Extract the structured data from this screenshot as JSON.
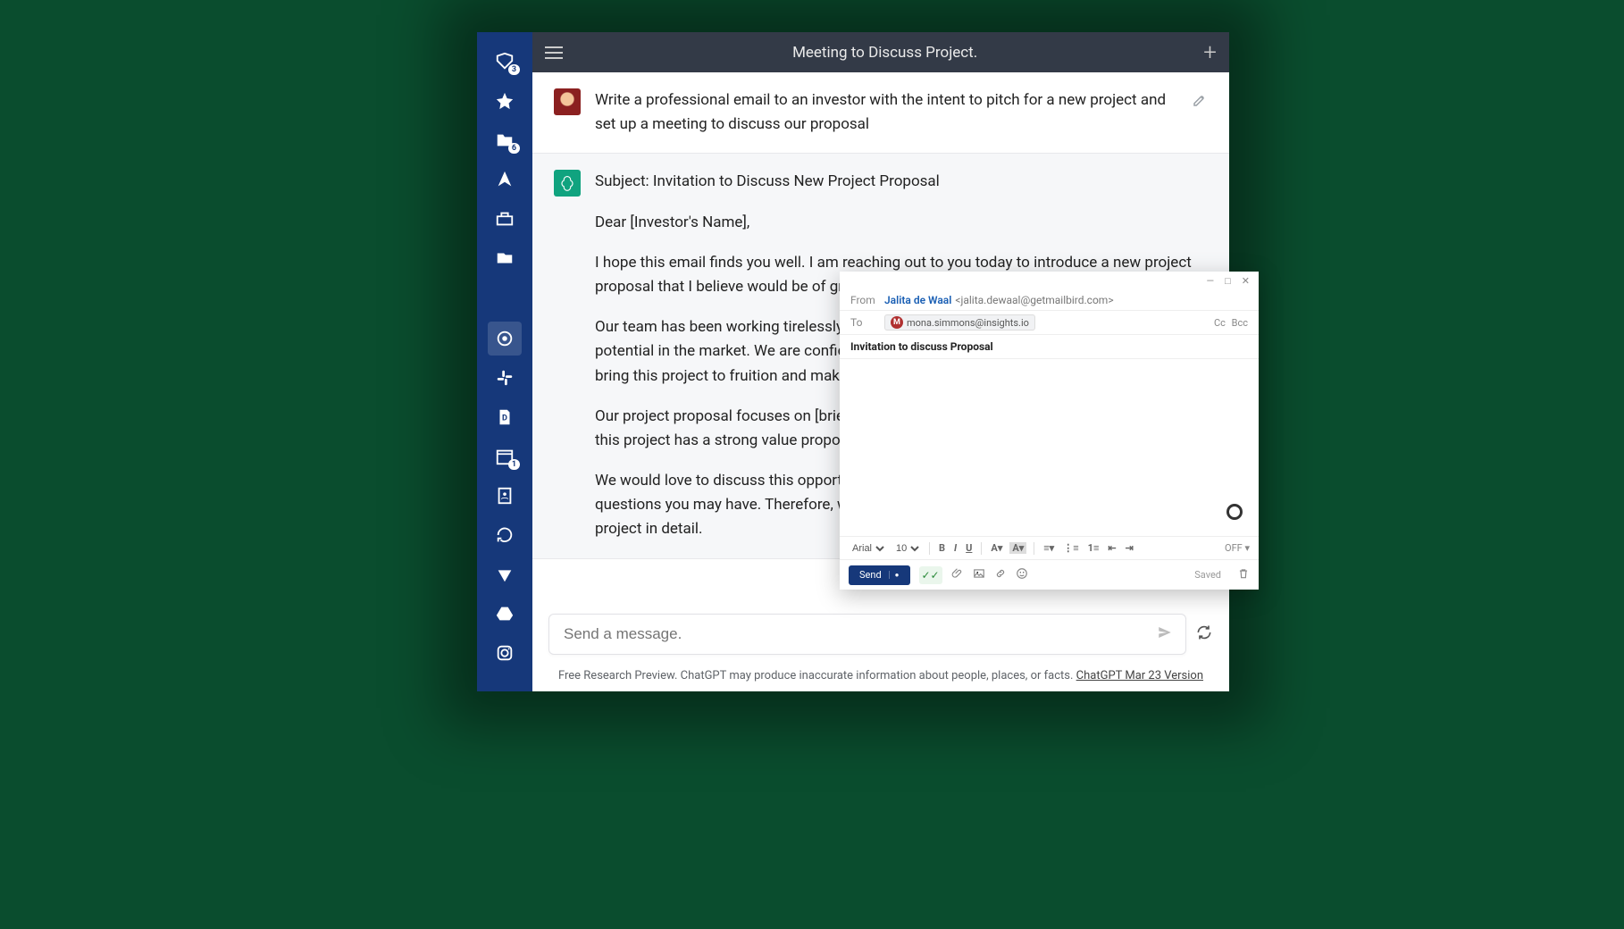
{
  "sidebar": {
    "badges": {
      "inbox": "3",
      "folder2": "6",
      "calendar": "1"
    }
  },
  "header": {
    "title": "Meeting to Discuss Project."
  },
  "chat": {
    "user_msg": "Write a professional email to an investor with the intent to pitch for a new project and set up a meeting to discuss our proposal",
    "ai": {
      "subject": "Subject: Invitation to Discuss New Project Proposal",
      "p1": "Dear [Investor's Name],",
      "p2": "I hope this email finds you well. I am reaching out to you today to introduce a new project proposal that I believe would be of great interest to you.",
      "p3": "Our team has been working tirelessly on a new project that we believe has tremendous potential in the market. We are confident that with your support and investment, we can bring this project to fruition and make a significant impact in our industry.",
      "p4": "Our project proposal focuses on [briefly describe the project and its goals]. We believe that this project has a strong value proposition and can create a sustainable business model.",
      "p5": "We would love to discuss this opportunity with you in more detail and answer any questions you may have. Therefore, we would like to invite you to a meeting to discuss our project in detail."
    }
  },
  "input": {
    "placeholder": "Send a message."
  },
  "footer": {
    "text": "Free Research Preview. ChatGPT may produce inaccurate information about people, places, or facts. ",
    "link": "ChatGPT Mar 23 Version"
  },
  "compose": {
    "from_label": "From",
    "from_name": "Jalita de Waal",
    "from_email": "<jalita.dewaal@getmailbird.com>",
    "to_label": "To",
    "to_initial": "M",
    "to_email": "mona.simmons@insights.io",
    "cc": "Cc",
    "bcc": "Bcc",
    "subject": "Invitation to discuss Proposal",
    "font": "Arial",
    "size": "10",
    "off": "OFF",
    "send": "Send",
    "saved": "Saved"
  }
}
